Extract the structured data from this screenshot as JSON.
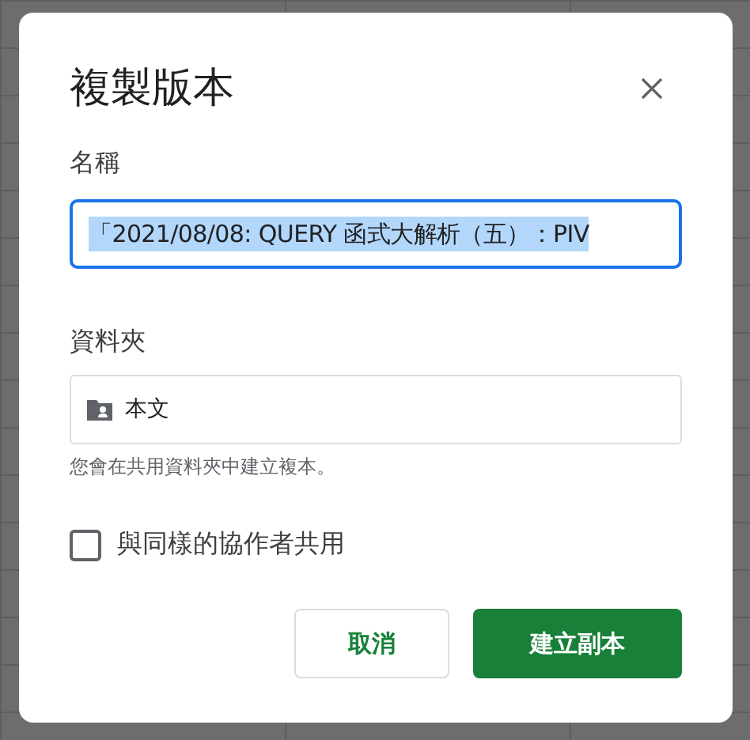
{
  "dialog": {
    "title": "複製版本"
  },
  "name_field": {
    "label": "名稱",
    "value": "「2021/08/08: QUERY 函式大解析（五）：PIV",
    "text_selected": true,
    "focused": true
  },
  "folder_field": {
    "label": "資料夾",
    "value": "本文",
    "hint": "您會在共用資料夾中建立複本。"
  },
  "share_option": {
    "label": "與同樣的協作者共用",
    "checked": false
  },
  "buttons": [
    {
      "label": "取消",
      "kind": "secondary"
    },
    {
      "label": "建立副本",
      "kind": "primary"
    }
  ]
}
